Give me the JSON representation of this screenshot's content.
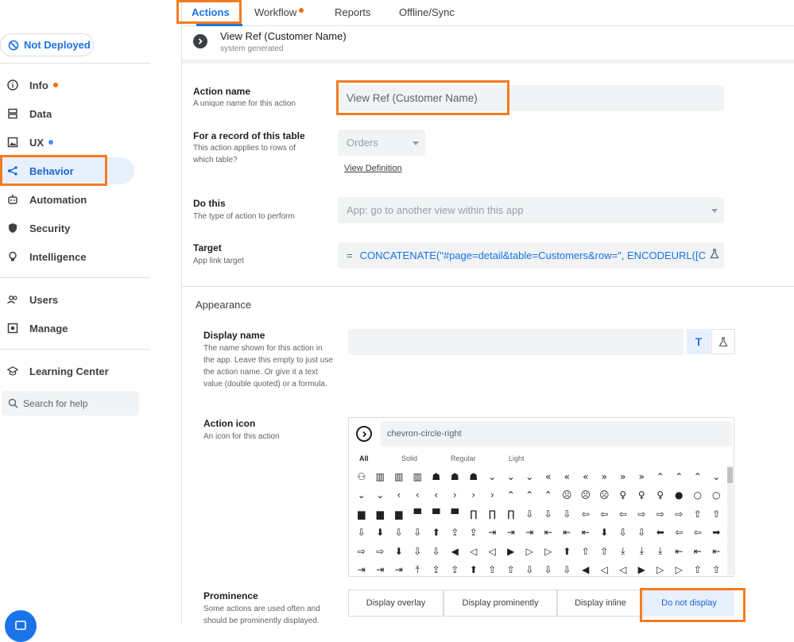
{
  "sidebar": {
    "deploy_status": "Not Deployed",
    "items": [
      {
        "label": "Info",
        "icon": "info-icon",
        "dot": "#e8710a"
      },
      {
        "label": "Data",
        "icon": "data-icon"
      },
      {
        "label": "UX",
        "icon": "ux-icon",
        "dot": "#4a8ff7"
      },
      {
        "label": "Behavior",
        "icon": "behavior-icon",
        "active": true
      },
      {
        "label": "Automation",
        "icon": "automation-icon"
      },
      {
        "label": "Security",
        "icon": "shield-icon"
      },
      {
        "label": "Intelligence",
        "icon": "lightbulb-icon"
      },
      {
        "label": "Users",
        "icon": "users-icon"
      },
      {
        "label": "Manage",
        "icon": "manage-icon"
      },
      {
        "label": "Learning Center",
        "icon": "graduation-cap-icon"
      }
    ],
    "search_placeholder": "Search for help"
  },
  "tabs": [
    {
      "label": "Actions",
      "active": true
    },
    {
      "label": "Workflow",
      "dot": "#e8710a"
    },
    {
      "label": "Reports"
    },
    {
      "label": "Offline/Sync"
    }
  ],
  "header": {
    "title": "View Ref (Customer Name)",
    "subtitle": "system generated"
  },
  "form": {
    "action_name": {
      "label": "Action name",
      "desc": "A unique name for this action",
      "value": "View Ref (Customer Name)"
    },
    "table": {
      "label": "For a record of this table",
      "desc": "This action applies to rows of which table?",
      "value": "Orders",
      "link": "View Definition"
    },
    "do_this": {
      "label": "Do this",
      "desc": "The type of action to perform",
      "value": "App: go to another view within this app"
    },
    "target": {
      "label": "Target",
      "desc": "App link target",
      "eq": "=",
      "value": "CONCATENATE(\"#page=detail&table=Customers&row=\", ENCODEURL([C"
    },
    "appearance_heading": "Appearance",
    "display_name": {
      "label": "Display name",
      "desc": "The name shown for this action in the app. Leave this empty to just use the action name. Or give it a text value (double quoted) or a formula.",
      "value": "",
      "text_button": "T"
    },
    "action_icon": {
      "label": "Action icon",
      "desc": "An icon for this action",
      "search_value": "chevron-circle-right",
      "filters": [
        "All",
        "Solid",
        "Regular",
        "Light"
      ],
      "glyphs": [
        "⚇",
        "▥",
        "▥",
        "▥",
        "☗",
        "☗",
        "☗",
        "⌄",
        "⌄",
        "⌄",
        "«",
        "«",
        "«",
        "»",
        "»",
        "»",
        "⌃",
        "⌃",
        "⌃",
        "⌄",
        "⌄",
        "⌄",
        "‹",
        "‹",
        "‹",
        "›",
        "›",
        "›",
        "⌃",
        "⌃",
        "⌃",
        "☹",
        "☹",
        "☹",
        "♀",
        "♀",
        "♀",
        "●",
        "○",
        "○",
        "▆",
        "▆",
        "▆",
        "▀",
        "▀",
        "▀",
        "∏",
        "∏",
        "∏",
        "⇩",
        "⇩",
        "⇩",
        "⇦",
        "⇦",
        "⇦",
        "⇨",
        "⇨",
        "⇨",
        "⇧",
        "⇧",
        "⇩",
        "⬇",
        "⇩",
        "⇩",
        "⬆",
        "⇪",
        "⇪",
        "⇥",
        "⇥",
        "⇥",
        "⇤",
        "⇤",
        "⇤",
        "⬇",
        "⇩",
        "⇩",
        "⬅",
        "⇦",
        "⇦",
        "➡",
        "⇨",
        "⇨",
        "⬇",
        "⇩",
        "⇩",
        "◀",
        "◁",
        "◁",
        "▶",
        "▷",
        "▷",
        "⬆",
        "⇧",
        "⇧",
        "⤓",
        "⤓",
        "⤓",
        "⇤",
        "⇤",
        "⇤",
        "⇥",
        "⇥",
        "⇥",
        "⤒",
        "⇪",
        "⇪",
        "⬆",
        "⇧",
        "⇧",
        "⇩",
        "⇩",
        "⇩",
        "◀",
        "◁",
        "◁",
        "▶",
        "▷",
        "▷",
        "⇧",
        "⇧"
      ]
    },
    "prominence": {
      "label": "Prominence",
      "desc": "Some actions are used often and should be prominently displayed.",
      "options": [
        "Display overlay",
        "Display prominently",
        "Display inline",
        "Do not display"
      ],
      "selected": "Do not display"
    }
  },
  "colors": {
    "accent": "#1a73e8",
    "highlight_box": "#f57c20",
    "active_bg": "#e8f0fe"
  }
}
